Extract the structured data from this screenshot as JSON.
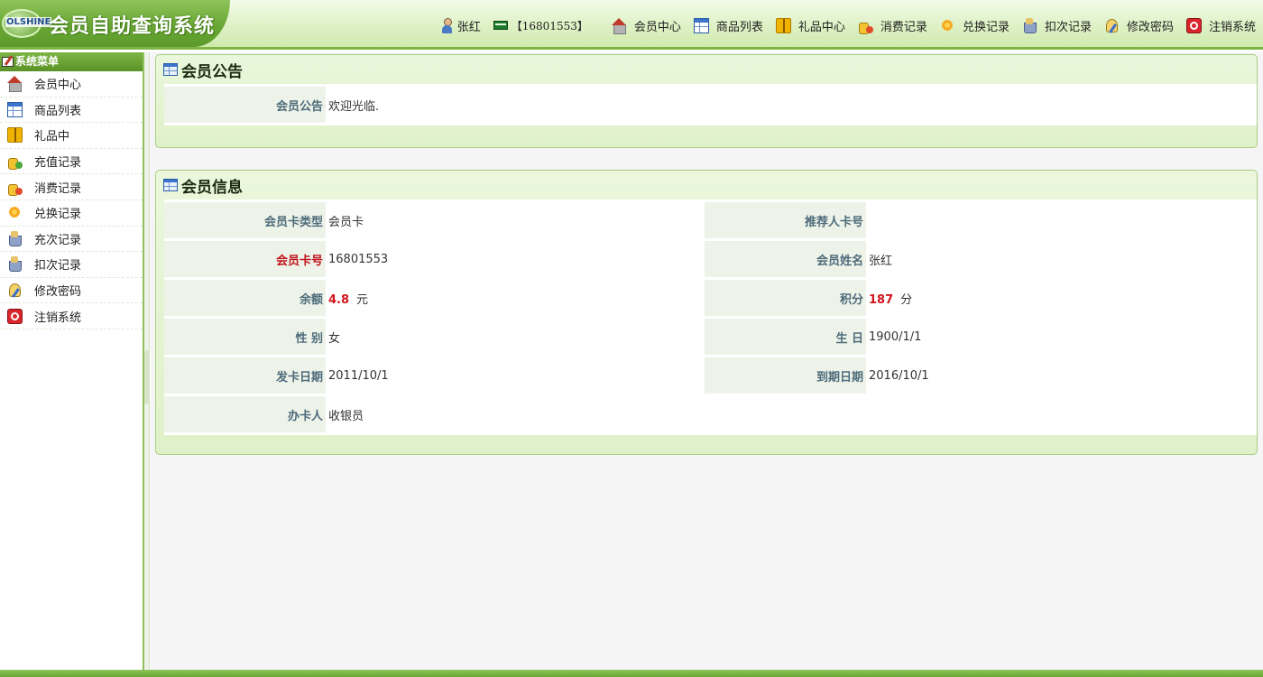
{
  "app": {
    "brand": "OLSHINE",
    "title": "会员自助查询系统"
  },
  "header": {
    "user_name": "张红",
    "card_display": "【16801553】",
    "nav": [
      {
        "label": "会员中心",
        "icon": "house-icon"
      },
      {
        "label": "商品列表",
        "icon": "table-icon"
      },
      {
        "label": "礼品中心",
        "icon": "gift-icon"
      },
      {
        "label": "消费记录",
        "icon": "coins-icon"
      },
      {
        "label": "兑换记录",
        "icon": "flower-icon"
      },
      {
        "label": "扣次记录",
        "icon": "basket-icon"
      },
      {
        "label": "修改密码",
        "icon": "pencil-icon"
      },
      {
        "label": "注销系统",
        "icon": "power-icon"
      }
    ]
  },
  "sidebar": {
    "title": "系统菜单",
    "items": [
      {
        "label": "会员中心",
        "icon": "house-icon"
      },
      {
        "label": "商品列表",
        "icon": "table-icon"
      },
      {
        "label": "礼品中",
        "icon": "gift-icon"
      },
      {
        "label": "充值记录",
        "icon": "coins-plus-icon"
      },
      {
        "label": "消费记录",
        "icon": "coins-icon"
      },
      {
        "label": "兑换记录",
        "icon": "flower-icon"
      },
      {
        "label": "充次记录",
        "icon": "basket-icon"
      },
      {
        "label": "扣次记录",
        "icon": "basket-icon"
      },
      {
        "label": "修改密码",
        "icon": "pencil-icon"
      },
      {
        "label": "注销系统",
        "icon": "power-icon"
      }
    ]
  },
  "notice": {
    "title": "会员公告",
    "label": "会员公告",
    "text": "欢迎光临."
  },
  "member": {
    "title": "会员信息",
    "card_type_label": "会员卡类型",
    "card_type": "会员卡",
    "referrer_label": "推荐人卡号",
    "referrer": "",
    "card_no_label": "会员卡号",
    "card_no": "16801553",
    "name_label": "会员姓名",
    "name": "张红",
    "balance_label": "余额",
    "balance": "4.8",
    "balance_unit": "元",
    "points_label": "积分",
    "points": "187",
    "points_unit": "分",
    "gender_label": "性 别",
    "gender": "女",
    "birthday_label": "生 日",
    "birthday": "1900/1/1",
    "issue_date_label": "发卡日期",
    "issue_date": "2011/10/1",
    "expiry_label": "到期日期",
    "expiry_date": "2016/10/1",
    "operator_label": "办卡人",
    "operator": "收银员"
  },
  "colors": {
    "accent_green": "#7db545",
    "label_bg": "#eef3ea",
    "highlight_red": "#d0121b"
  }
}
